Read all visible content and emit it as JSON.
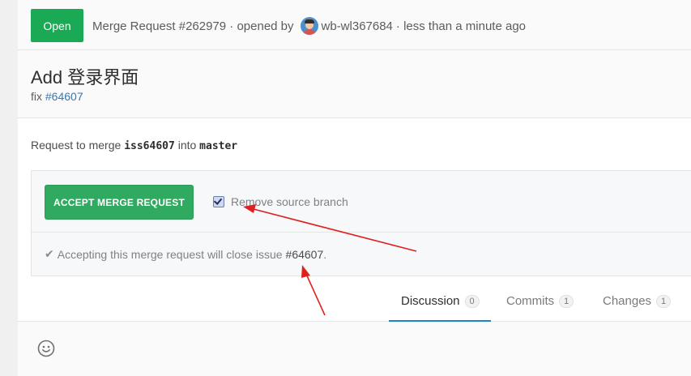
{
  "header": {
    "status": "Open",
    "meta_before": "Merge Request #262979 · opened by",
    "author": "wb-wl367684",
    "meta_after": "· less than a minute ago"
  },
  "title": {
    "text": "Add 登录界面",
    "desc_prefix": "fix",
    "desc_issue": "#64607"
  },
  "merge": {
    "intro": "Request to merge",
    "source": "iss64607",
    "into": "into",
    "target": "master",
    "accept_label": "ACCEPT MERGE REQUEST",
    "remove_branch_label": "Remove source branch",
    "remove_branch_checked": true,
    "close_note": "Accepting this merge request will close issue",
    "close_issue": "#64607",
    "close_suffix": "."
  },
  "tabs": [
    {
      "label": "Discussion",
      "count": "0",
      "active": true
    },
    {
      "label": "Commits",
      "count": "1",
      "active": false
    },
    {
      "label": "Changes",
      "count": "1",
      "active": false
    }
  ],
  "colors": {
    "status_green": "#1aaa55",
    "accept_green": "#2faa60",
    "link_blue": "#3777b0",
    "tab_underline": "#1b84c6",
    "annotation_arrow": "#e0201c"
  },
  "icons": [
    "check-icon",
    "smiley-icon"
  ]
}
